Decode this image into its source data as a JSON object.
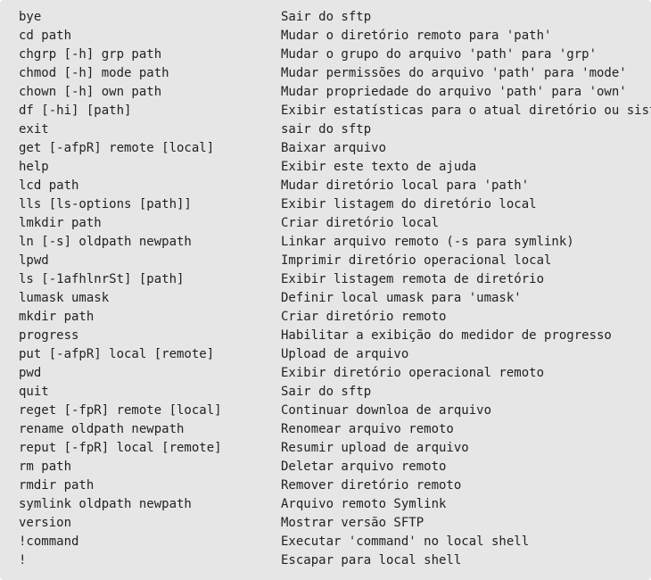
{
  "rows": [
    {
      "cmd": "bye",
      "desc": "Sair do sftp"
    },
    {
      "cmd": "cd path",
      "desc": "Mudar o diretório remoto para 'path'"
    },
    {
      "cmd": "chgrp [-h] grp path",
      "desc": "Mudar o grupo do arquivo 'path' para 'grp'"
    },
    {
      "cmd": "chmod [-h] mode path",
      "desc": "Mudar permissões do arquivo 'path' para 'mode'"
    },
    {
      "cmd": "chown [-h] own path",
      "desc": "Mudar propriedade do arquivo 'path' para 'own'"
    },
    {
      "cmd": "df [-hi] [path]",
      "desc": "Exibir estatísticas para o atual diretório ou sist"
    },
    {
      "cmd": "exit",
      "desc": "sair do sftp"
    },
    {
      "cmd": "get [-afpR] remote [local]",
      "desc": "Baixar arquivo"
    },
    {
      "cmd": "help",
      "desc": "Exibir este texto de ajuda"
    },
    {
      "cmd": "lcd path",
      "desc": "Mudar diretório local para 'path'"
    },
    {
      "cmd": "lls [ls-options [path]]",
      "desc": "Exibir listagem do diretório local"
    },
    {
      "cmd": "lmkdir path",
      "desc": "Criar diretório local"
    },
    {
      "cmd": "ln [-s] oldpath newpath",
      "desc": "Linkar arquivo remoto (-s para symlink)"
    },
    {
      "cmd": "lpwd",
      "desc": "Imprimir diretório operacional local"
    },
    {
      "cmd": "ls [-1afhlnrSt] [path]",
      "desc": "Exibir listagem remota de diretório"
    },
    {
      "cmd": "lumask umask",
      "desc": "Definir local umask para 'umask'"
    },
    {
      "cmd": "mkdir path",
      "desc": "Criar diretório remoto"
    },
    {
      "cmd": "progress",
      "desc": "Habilitar a exibição do medidor de progresso"
    },
    {
      "cmd": "put [-afpR] local [remote]",
      "desc": "Upload de arquivo"
    },
    {
      "cmd": "pwd",
      "desc": "Exibir diretório operacional remoto"
    },
    {
      "cmd": "quit",
      "desc": "Sair do sftp"
    },
    {
      "cmd": "reget [-fpR] remote [local]",
      "desc": "Continuar downloa de arquivo"
    },
    {
      "cmd": "rename oldpath newpath",
      "desc": "Renomear arquivo remoto"
    },
    {
      "cmd": "reput [-fpR] local [remote]",
      "desc": "Resumir upload de arquivo"
    },
    {
      "cmd": "rm path",
      "desc": "Deletar arquivo remoto"
    },
    {
      "cmd": "rmdir path",
      "desc": "Remover diretório remoto"
    },
    {
      "cmd": "symlink oldpath newpath",
      "desc": "Arquivo remoto Symlink"
    },
    {
      "cmd": "version",
      "desc": "Mostrar versão SFTP"
    },
    {
      "cmd": "!command",
      "desc": "Executar 'command' no local shell"
    },
    {
      "cmd": "!",
      "desc": "Escapar para local shell"
    }
  ]
}
